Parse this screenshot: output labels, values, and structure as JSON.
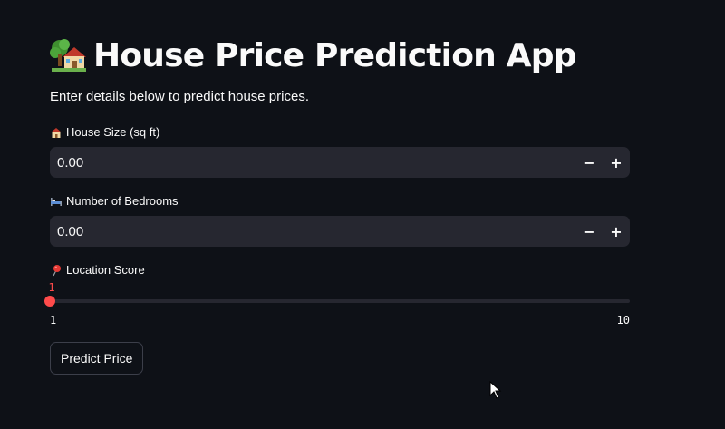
{
  "header": {
    "title": "House Price Prediction App",
    "title_icon": "house-with-garden-icon"
  },
  "intro": {
    "text": "Enter details below to predict house prices."
  },
  "fields": {
    "house_size": {
      "icon": "house-icon",
      "label": "House Size (sq ft)",
      "value": "0.00",
      "decrement_label": "−",
      "increment_label": "+"
    },
    "bedrooms": {
      "icon": "bed-icon",
      "label": "Number of Bedrooms",
      "value": "0.00",
      "decrement_label": "−",
      "increment_label": "+"
    },
    "location_score": {
      "icon": "round-pushpin-icon",
      "label": "Location Score",
      "current_value": "1",
      "min_label": "1",
      "max_label": "10",
      "value_fraction": 0
    }
  },
  "actions": {
    "predict_label": "Predict Price"
  },
  "theme": {
    "background": "#0e1117",
    "input_background": "#262730",
    "accent": "#ff4b4b",
    "text": "#fafafa"
  }
}
